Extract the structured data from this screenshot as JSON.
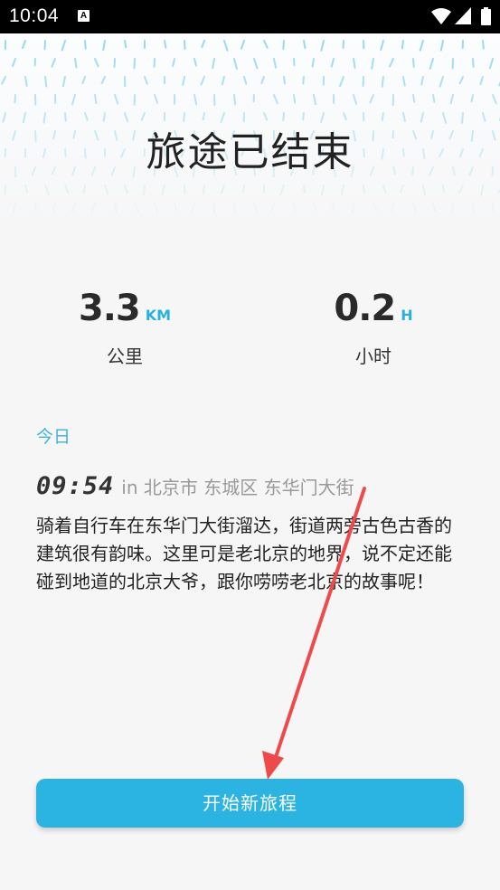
{
  "status": {
    "time": "10:04",
    "notification_glyph": "A"
  },
  "title": "旅途已结束",
  "stats": {
    "distance": {
      "value": "3.3",
      "unit": "KM",
      "label": "公里"
    },
    "duration": {
      "value": "0.2",
      "unit": "H",
      "label": "小时"
    }
  },
  "day_label": "今日",
  "entry": {
    "time": "09:54",
    "location": "in 北京市 东城区 东华门大街",
    "text": "骑着自行车在东华门大街溜达，街道两旁古色古香的建筑很有韵味。这里可是老北京的地界，说不定还能碰到地道的北京大爷，跟你唠唠老北京的故事呢！"
  },
  "start_button": "开始新旅程",
  "colors": {
    "accent": "#2bb3e1",
    "annotation_arrow": "#ef4a4a"
  }
}
